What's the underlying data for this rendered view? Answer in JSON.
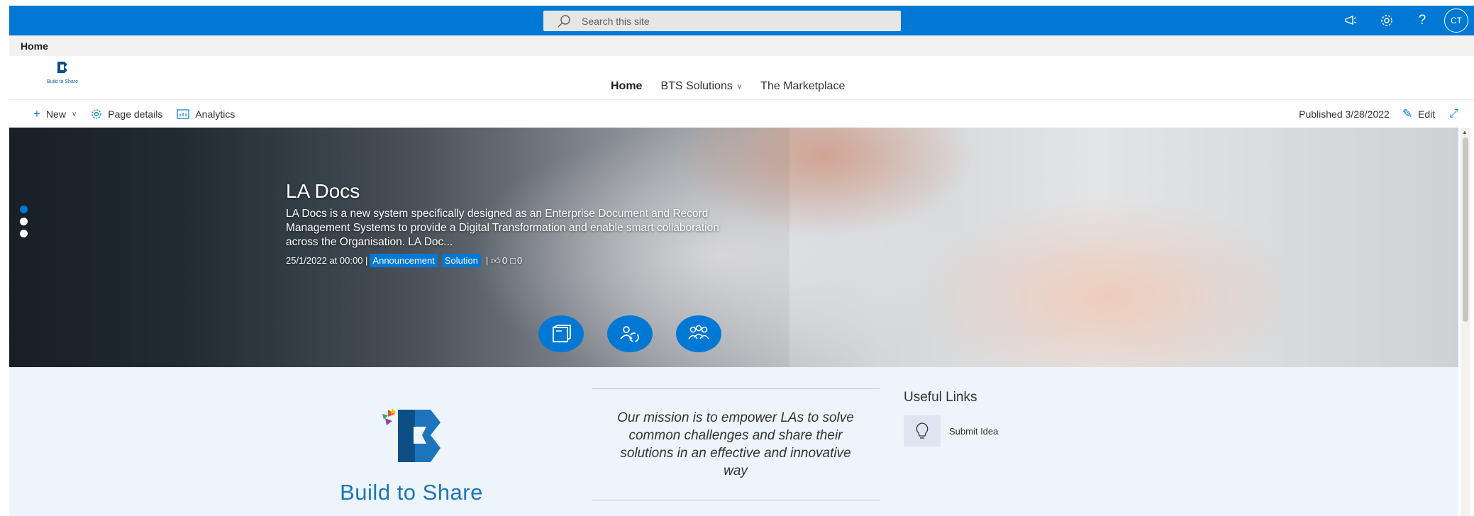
{
  "suitebar": {
    "search_placeholder": "Search this site",
    "avatar_initials": "CT",
    "help_glyph": "?"
  },
  "breadcrumb": {
    "label": "Home"
  },
  "header": {
    "logo_caption": "Build to Share",
    "nav": [
      {
        "label": "Home",
        "active": true
      },
      {
        "label": "BTS Solutions",
        "has_dropdown": true
      },
      {
        "label": "The Marketplace"
      }
    ]
  },
  "commandbar": {
    "new_label": "New",
    "page_details_label": "Page details",
    "analytics_label": "Analytics",
    "published_label": "Published 3/28/2022",
    "edit_label": "Edit"
  },
  "hero": {
    "title": "LA Docs",
    "description": "LA Docs is a new system specifically designed as an Enterprise Document and Record Management Systems to provide a Digital Transformation and enable smart collaboration across the Organisation. LA Doc...",
    "date": "25/1/2022 at 00:00 |",
    "tags": [
      "Announcement",
      "Solution"
    ],
    "separator": "|",
    "likes": "0",
    "comments": "0",
    "active_slide": 1,
    "slide_count": 3
  },
  "section": {
    "logo_word": "Build to Share",
    "mission": "Our mission is to empower LAs to solve common challenges and share their solutions in an effective and innovative way",
    "useful_links_title": "Useful Links",
    "links": [
      {
        "label": "Submit Idea",
        "icon": "lightbulb-icon"
      }
    ]
  },
  "colors": {
    "accent": "#0078d4",
    "section_bg": "#eef4fb",
    "logo_blue": "#1c75bc"
  }
}
